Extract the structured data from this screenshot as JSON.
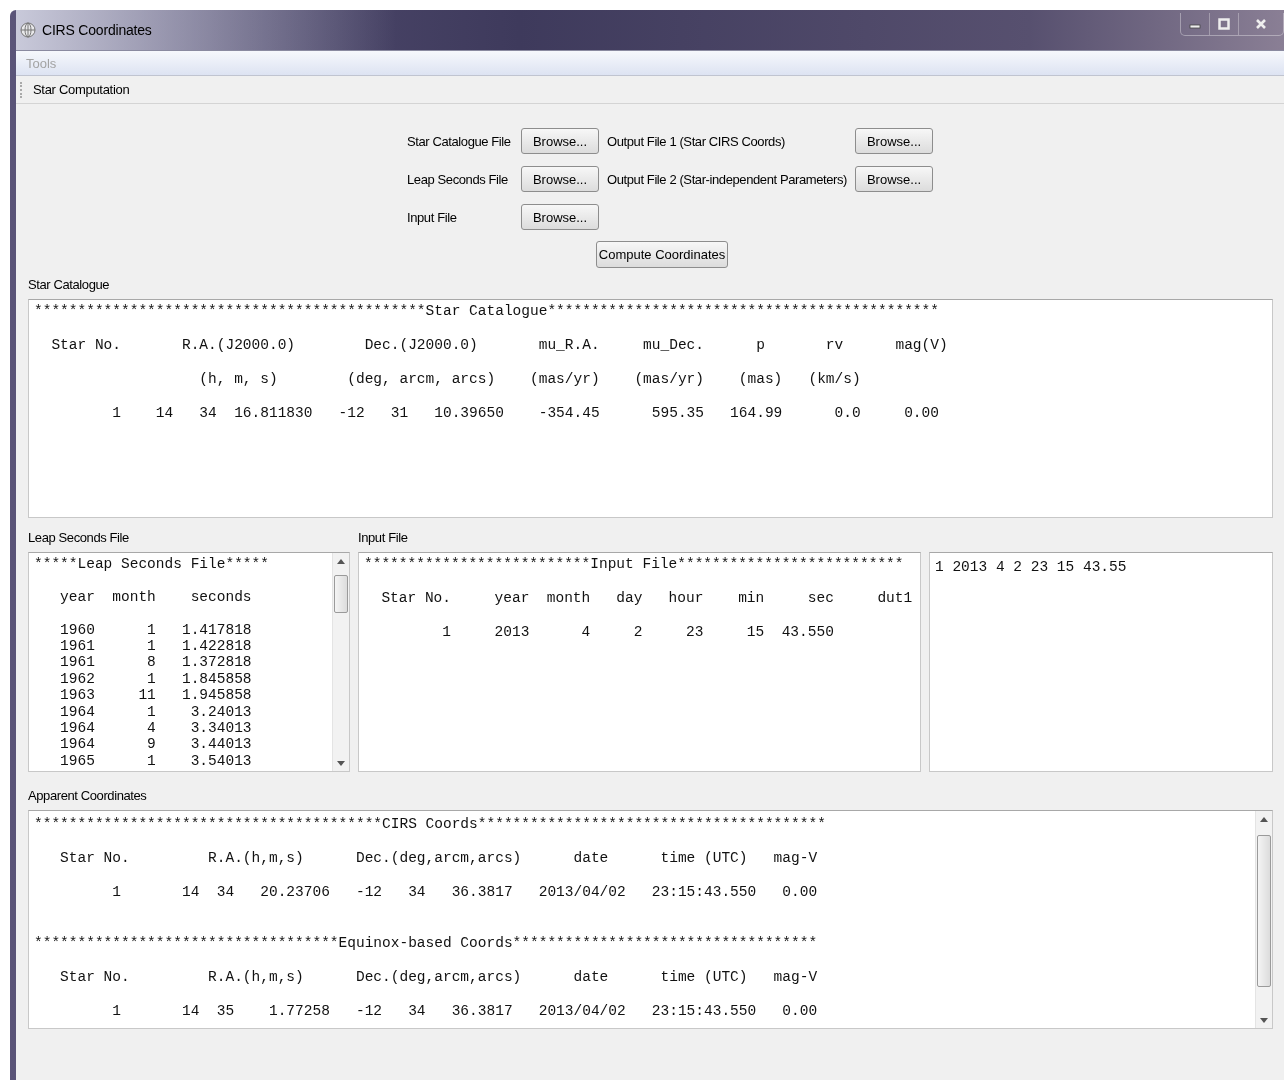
{
  "window": {
    "title": "CIRS Coordinates"
  },
  "menu": [
    {
      "label": "Tools",
      "disabled": true
    }
  ],
  "toolbar": [
    {
      "label": "Star Computation"
    }
  ],
  "files": [
    {
      "label": "Star Catalogue File",
      "button": "Browse..."
    },
    {
      "label": "Leap Seconds File",
      "button": "Browse..."
    },
    {
      "label": "Input File",
      "button": "Browse..."
    }
  ],
  "outputs": [
    {
      "label": "Output File 1 (Star CIRS Coords)",
      "button": "Browse..."
    },
    {
      "label": "Output File 2 (Star-independent Parameters)",
      "button": "Browse..."
    }
  ],
  "compute_button": "Compute Coordinates",
  "star_catalogue": {
    "label": "Star Catalogue",
    "text": "*********************************************Star Catalogue*********************************************\n\n  Star No.       R.A.(J2000.0)        Dec.(J2000.0)       mu_R.A.     mu_Dec.      p       rv      mag(V)\n\n                   (h, m, s)        (deg, arcm, arcs)    (mas/yr)    (mas/yr)    (mas)   (km/s)\n\n         1    14   34  16.811830   -12   31   10.39650    -354.45      595.35   164.99      0.0     0.00"
  },
  "leap_seconds": {
    "label": "Leap Seconds File",
    "text": "*****Leap Seconds File*****\n\n   year  month    seconds\n\n   1960      1   1.417818\n   1961      1   1.422818\n   1961      8   1.372818\n   1962      1   1.845858\n   1963     11   1.945858\n   1964      1    3.24013\n   1964      4    3.34013\n   1964      9    3.44013\n   1965      1    3.54013"
  },
  "input_file": {
    "label": "Input File",
    "text": "**************************Input File**************************\n\n  Star No.     year  month   day   hour    min     sec     dut1\n\n         1     2013      4     2     23     15  43.550"
  },
  "raw_input": {
    "text": "1 2013 4 2 23 15 43.55"
  },
  "apparent": {
    "label": "Apparent Coordinates",
    "text": "****************************************CIRS Coords****************************************\n\n   Star No.         R.A.(h,m,s)      Dec.(deg,arcm,arcs)      date      time (UTC)   mag-V\n\n         1       14  34   20.23706   -12   34   36.3817   2013/04/02   23:15:43.550   0.00\n\n\n***********************************Equinox-based Coords***********************************\n\n   Star No.         R.A.(h,m,s)      Dec.(deg,arcm,arcs)      date      time (UTC)   mag-V\n\n         1       14  35    1.77258   -12   34   36.3817   2013/04/02   23:15:43.550   0.00"
  }
}
